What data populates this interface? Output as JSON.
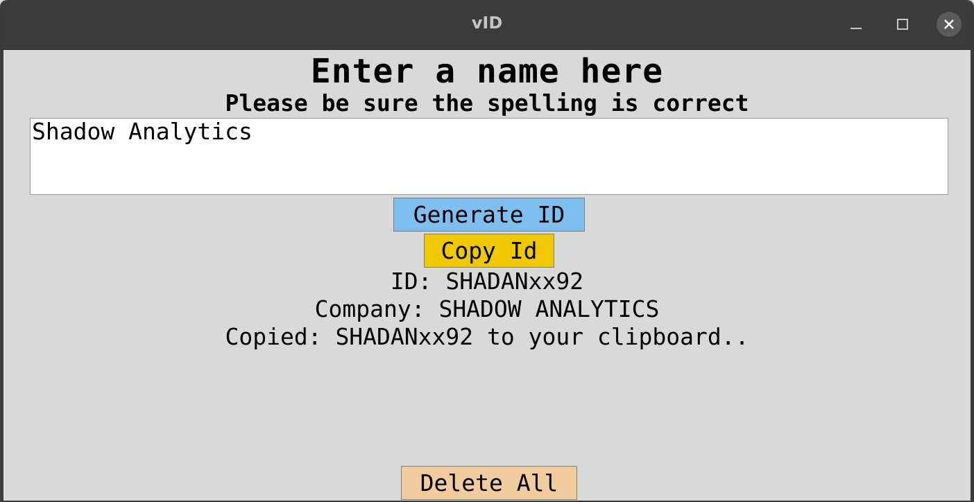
{
  "window": {
    "title": "vID",
    "controls": {
      "minimize_icon": "minimize-icon",
      "maximize_icon": "maximize-icon",
      "close_icon": "close-icon"
    }
  },
  "form": {
    "heading": "Enter a name here",
    "subheading": "Please be sure the spelling is correct",
    "name_value": "Shadow Analytics"
  },
  "buttons": {
    "generate_label": "Generate ID",
    "copy_label": "Copy Id",
    "delete_label": "Delete All"
  },
  "results": {
    "id_line": "ID: SHADANxx92",
    "company_line": "Company: SHADOW ANALYTICS",
    "copied_line": "Copied: SHADANxx92 to your clipboard.."
  },
  "colors": {
    "titlebar": "#3b3b3b",
    "background": "#d9d9d9",
    "generate_button": "#7fbff0",
    "copy_button": "#f0c800",
    "delete_button": "#f0cc9f"
  }
}
